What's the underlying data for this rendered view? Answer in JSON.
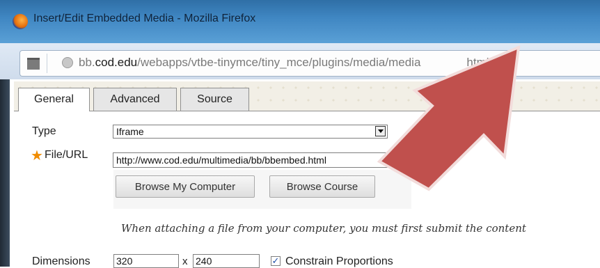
{
  "window": {
    "title": "Insert/Edit Embedded Media - Mozilla Firefox"
  },
  "address_bar": {
    "url_host": "bb.cod.edu",
    "url_prefix": "bb.",
    "url_domain": "cod.edu",
    "url_path_visible": "/webapps/vtbe-tinymce/tiny_mce/plugins/media/media",
    "url_tail_visible": "htmlData"
  },
  "tabs": [
    {
      "label": "General",
      "active": true
    },
    {
      "label": "Advanced",
      "active": false
    },
    {
      "label": "Source",
      "active": false
    }
  ],
  "form": {
    "type_label": "Type",
    "type_value": "Iframe",
    "file_label": "File/URL",
    "file_value": "http://www.cod.edu/multimedia/bb/bbembed.html",
    "browse_computer_label": "Browse My Computer",
    "browse_course_label": "Browse Course",
    "note": "When attaching a file from your computer, you must first submit the content",
    "dimensions_label": "Dimensions",
    "width_value": "320",
    "x_label": "x",
    "height_value": "240",
    "constrain_label": "Constrain Proportions",
    "constrain_checked": true
  },
  "annotation": {
    "arrow_color": "#c0504d",
    "arrow_outline": "#f2dcdb",
    "icon": "red-arrow-pointing-at-url-field"
  },
  "colors": {
    "titlebar": "#3f86c2",
    "required_star": "#f08c00"
  }
}
